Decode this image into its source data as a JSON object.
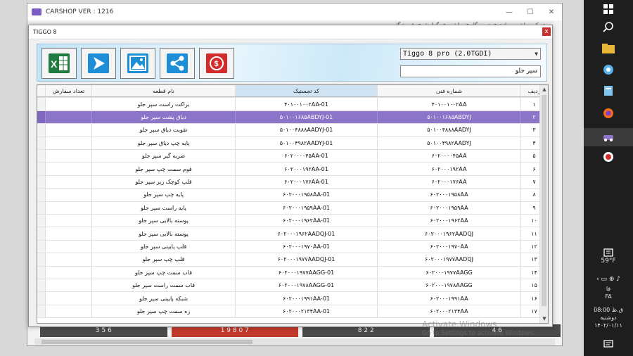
{
  "window": {
    "title": "CARSHOP VER : 1216",
    "minimize": "—",
    "maximize": "☐",
    "close": "✕"
  },
  "background": {
    "menu_text": "شرکت ماشین سازی ◄ تعمیرگاه ◄ ماشین ◄ گزارش ◄ فروشگاه",
    "buttons": [
      "3 5 6",
      "1 9 8 0 7",
      "8 2 2",
      "4 6"
    ]
  },
  "dialog": {
    "title": "TIGGO 8",
    "close": "x"
  },
  "toolbar": {
    "buttons": [
      "excel-icon",
      "send-icon",
      "image-icon",
      "share-icon",
      "money-icon"
    ],
    "model": "Tiggo 8 pro (2.0TGDI)",
    "search": "سپر جلو"
  },
  "table": {
    "headers": [
      "تعداد سفارش",
      "نام قطعه",
      "کد تجستیک",
      "شماره فنی",
      "ردیف"
    ],
    "rows": [
      [
        "",
        "براکت راست سپر جلو",
        "۴۰۱۰۰۱۰۰۲AA-01",
        "۴۰۱۰۰۱۰۰۲AA",
        "۱"
      ],
      [
        "",
        "دیاق پشت سپر جلو",
        "۵۰۱۰۰۱۶۸۵ABDYJ-01",
        "۵۰۱۰۰۱۶۸۵ABDYJ",
        "۲"
      ],
      [
        "",
        "تقویت دیاق سپر جلو",
        "۵۰۱۰۰۴۸۸۸AADYJ-01",
        "۵۰۱۰۰۴۸۸۸AADYJ",
        "۳"
      ],
      [
        "",
        "پایه چپ دیاق سپر جلو",
        "۵۰۱۰۰۴۹۸۲AADYJ-01",
        "۵۰۱۰۰۴۹۸۲AADYJ",
        "۴"
      ],
      [
        "",
        "ضربه گیر سپر جلو",
        "۶۰۲۰۰۰۰۴۵AA-01",
        "۶۰۲۰۰۰۰۴۵AA",
        "۵"
      ],
      [
        "",
        "فوم سمت چپ سپر جلو",
        "۶۰۲۰۰۰۱۹۲AA-01",
        "۶۰۲۰۰۰۱۹۲AA",
        "۶"
      ],
      [
        "",
        "قلپ کوچک زیر سپر جلو",
        "۶۰۲۰۰۰۱۷۶AA-01",
        "۶۰۲۰۰۰۱۷۶AA",
        "۷"
      ],
      [
        "",
        "پایه چپ سپر جلو",
        "۶۰۲۰۰۰۱۹۵۸AA-01",
        "۶۰۲۰۰۰۱۹۵۸AA",
        "۸"
      ],
      [
        "",
        "پایه راست سپر جلو",
        "۶۰۲۰۰۰۱۹۵۹AA-01",
        "۶۰۲۰۰۰۱۹۵۹AA",
        "۹"
      ],
      [
        "",
        "پوسته بالایی سپر جلو",
        "۶۰۲۰۰۰۱۹۶۲AA-01",
        "۶۰۲۰۰۰۱۹۶۲AA",
        "۱۰"
      ],
      [
        "",
        "پوسته بالایی سپر جلو",
        "۶۰۲۰۰۰۱۹۶۲AADQJ-01",
        "۶۰۲۰۰۰۱۹۶۲AADQJ",
        "۱۱"
      ],
      [
        "",
        "قلپ پایینی سپر جلو",
        "۶۰۲۰۰۰۱۹۷۰AA-01",
        "۶۰۲۰۰۰۱۹۷۰AA",
        "۱۲"
      ],
      [
        "",
        "قلپ چپ سپر جلو",
        "۶۰۲۰۰۰۱۹۷۷AADQJ-01",
        "۶۰۲۰۰۰۱۹۷۷AADQJ",
        "۱۳"
      ],
      [
        "",
        "قاب سمت چپ سپر جلو",
        "۶۰۲۰۰۰۱۹۷۷AAGG-01",
        "۶۰۲۰۰۰۱۹۷۷AAGG",
        "۱۴"
      ],
      [
        "",
        "قاب سمت راست سپر جلو",
        "۶۰۲۰۰۰۱۹۷۸AAGG-01",
        "۶۰۲۰۰۰۱۹۷۸AAGG",
        "۱۵"
      ],
      [
        "",
        "شبکه پایینی سپر جلو",
        "۶۰۲۰۰۰۱۹۹۱AA-01",
        "۶۰۲۰۰۰۱۹۹۱AA",
        "۱۶"
      ],
      [
        "",
        "زه سمت چپ سپر جلو",
        "۶۰۲۰۰۰۲۱۳۴AA-01",
        "۶۰۲۰۰۰۲۱۳۴AA",
        "۱۷"
      ]
    ],
    "selected_row": 1
  },
  "watermark": {
    "line1": "Activate Windows",
    "line2": "Go to Settings to activate Windows."
  },
  "taskbar": {
    "weather": "59°F",
    "lang": "فا",
    "lang2": "FA",
    "time": "08:00 ق.ظ",
    "day": "دوشنبه",
    "date": "۱۴۰۲/۰۱/۱۱"
  }
}
